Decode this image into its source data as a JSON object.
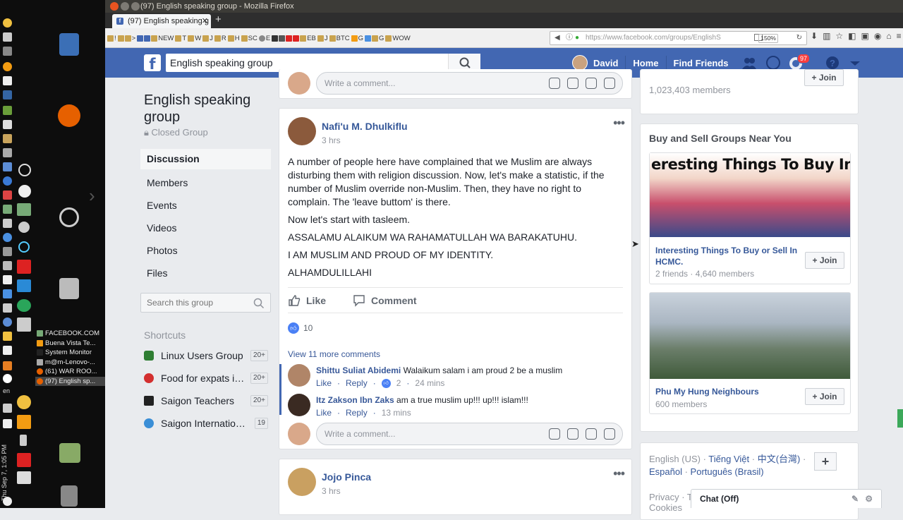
{
  "window": {
    "title": "(97) English speaking group - Mozilla Firefox",
    "tab_title": "(97) English speaking g",
    "url": "https://www.facebook.com/groups/EnglishS",
    "zoom": "150%"
  },
  "bookmarks": [
    "!",
    ">",
    "NEW",
    "T",
    "W",
    "J",
    "R",
    "H",
    "SC",
    "E",
    "EB",
    "J",
    "BTC",
    "G",
    "G",
    "WOW"
  ],
  "desktop": {
    "clock": "Thu Sep 7, 1:05 PM",
    "lang": "en",
    "tasks": [
      "FACEBOOK.COM",
      "Buena Vista Te...",
      "System Monitor",
      "m@m-Lenovo-...",
      "(61) WAR ROO...",
      "(97) English sp..."
    ]
  },
  "fb": {
    "search_value": "English speaking group",
    "user": "David",
    "nav_home": "Home",
    "nav_find": "Find Friends",
    "notif_count": "97"
  },
  "group": {
    "title": "English speaking group",
    "privacy": "Closed Group",
    "nav": [
      "Discussion",
      "Members",
      "Events",
      "Videos",
      "Photos",
      "Files"
    ],
    "search_placeholder": "Search this group",
    "shortcuts_label": "Shortcuts",
    "shortcuts": [
      {
        "label": "Linux Users Group",
        "count": "20+"
      },
      {
        "label": "Food for expats in ...",
        "count": "20+"
      },
      {
        "label": "Saigon Teachers",
        "count": "20+"
      },
      {
        "label": "Saigon International ...",
        "count": "19"
      }
    ]
  },
  "feed": {
    "top_comment_placeholder": "Write a comment...",
    "post": {
      "author": "Nafi'u M. Dhulkiflu",
      "time": "3 hrs",
      "paragraphs": [
        "A number of people here have complained that we Muslim are always disturbing them with religion discussion. Now, let's make a statistic, if the number of Muslim override non-Muslim. Then, they have no right to complain. The 'leave buttom' is there.",
        "Now let's start with tasleem.",
        "ASSALAMU ALAIKUM WA RAHAMATULLAH WA BARAKATUHU.",
        "I AM MUSLIM AND PROUD OF MY IDENTITY.",
        "ALHAMDULILLAHI"
      ],
      "like_label": "Like",
      "comment_label": "Comment",
      "like_count": "10",
      "view_more": "View 11 more comments",
      "comments": [
        {
          "author": "Shittu Suliat Abidemi",
          "text": "Walaikum salam i am proud 2 be a muslim",
          "like": "Like",
          "reply": "Reply",
          "likes": "2",
          "time": "24 mins"
        },
        {
          "author": "Itz Zakson Ibn Zaks",
          "text": "am a true muslim up!!! up!!! islam!!!",
          "like": "Like",
          "reply": "Reply",
          "time": "13 mins"
        }
      ],
      "comment_placeholder": "Write a comment..."
    },
    "post2": {
      "author": "Jojo Pinca",
      "time": "3 hrs"
    }
  },
  "right": {
    "top_members": "1,023,403 members",
    "join_label": "Join",
    "section_title": "Buy and Sell Groups Near You",
    "banner_text": "eresting Things To Buy In HCM",
    "groups": [
      {
        "name": "Interesting Things To Buy or Sell In HCMC.",
        "meta": "2 friends · 4,640 members"
      },
      {
        "name": "Phu My Hung Neighbours",
        "meta": "600 members"
      }
    ],
    "languages": {
      "current": "English (US)",
      "others": [
        "Tiếng Việt",
        "中文(台灣)",
        "Español",
        "Português (Brasil)"
      ]
    },
    "privacy": "Privacy · T",
    "cookies": "Cookies"
  },
  "chat": {
    "label": "Chat (Off)"
  }
}
